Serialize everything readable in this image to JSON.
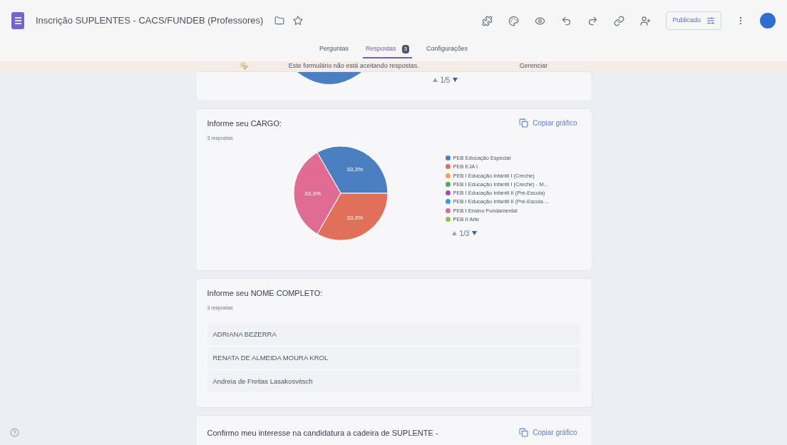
{
  "header": {
    "title": "Inscrição SUPLENTES - CACS/FUNDEB (Professores)",
    "publish_button": "Publicado"
  },
  "tabs": [
    {
      "label": "Perguntas",
      "selected": false
    },
    {
      "label": "Respostas",
      "badge": "3",
      "selected": true
    },
    {
      "label": "Configurações",
      "selected": false
    }
  ],
  "banner": {
    "message": "Este formulário não está aceitando respostas.",
    "action": "Gerenciar"
  },
  "cards": [
    {
      "kind": "pie_partial",
      "pager": "1/5"
    },
    {
      "kind": "pie",
      "title": "Informe seu CARGO:",
      "count": "3 respostas",
      "copy_label": "Copiar gráfico",
      "pager": "1/3",
      "chart_data": {
        "type": "pie",
        "categories": [
          "PEB Educação Especial",
          "PEB EJA I",
          "PEB I Educação Infantil I (Creche)",
          "PEB I Educação Infantil I (Creche) - M...",
          "PEB I Educação Infantil II (Pré-Escola)",
          "PEB I Educação Infantil II (Pré-Escola ...",
          "PEB I Ensino Fundamental",
          "PEB II Arte"
        ],
        "colors": [
          "#4a7fc1",
          "#e0705a",
          "#f4a742",
          "#4caf50",
          "#9c4fb5",
          "#2fa3e0",
          "#e06c93",
          "#8bc34a"
        ],
        "legend": "right",
        "series": [
          {
            "values": [
              33.3,
              33.3,
              0,
              0,
              0,
              0,
              33.3,
              0
            ]
          }
        ],
        "value_labels": [
          "33,3%",
          "33,3%",
          "33,3%"
        ]
      }
    },
    {
      "kind": "list",
      "title": "Informe seu NOME COMPLETO:",
      "count": "3 respostas",
      "answers": [
        "ADRIANA BEZERRA",
        "RENATA DE ALMEIDA MOURA KROL",
        "Andreia de Freitas Lasakosvitsch"
      ]
    },
    {
      "kind": "partial",
      "title": "Confirmo meu interesse na candidatura a cadeira de SUPLENTE -",
      "copy_label": "Copiar gráfico"
    }
  ]
}
